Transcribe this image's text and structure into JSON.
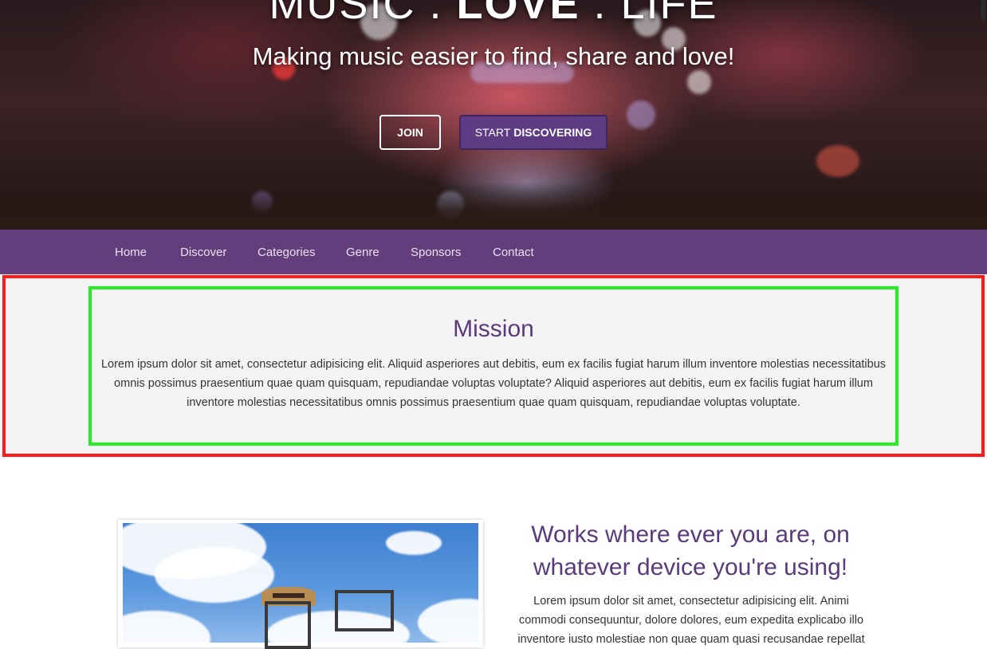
{
  "hero": {
    "title_part1": "MUSIC . ",
    "title_part2": "LOVE",
    "title_part3": " . LIFE",
    "subtitle": "Making music easier to find, share and love!",
    "join_label": "JOIN",
    "start_label_light": "START",
    "start_label_bold": "DISCOVERING"
  },
  "nav": {
    "items": [
      "Home",
      "Discover",
      "Categories",
      "Genre",
      "Sponsors",
      "Contact"
    ]
  },
  "mission": {
    "title": "Mission",
    "text": "Lorem ipsum dolor sit amet, consectetur adipisicing elit. Aliquid asperiores aut debitis, eum ex facilis fugiat harum illum inventore molestias necessitatibus omnis possimus praesentium quae quam quisquam, repudiandae voluptas voluptate? Aliquid asperiores aut debitis, eum ex facilis fugiat harum illum inventore molestias necessitatibus omnis possimus praesentium quae quam quisquam, repudiandae voluptas voluptate."
  },
  "feature": {
    "title": "Works where ever you are, on whatever device you're using!",
    "text": "Lorem ipsum dolor sit amet, consectetur adipisicing elit. Animi commodi consequuntur, dolore dolores, eum expedita explicabo illo inventore iusto molestiae non quae quam quasi recusandae repellat"
  },
  "colors": {
    "nav_bg": "#633d7c",
    "accent_button": "#5e3c84",
    "heading": "#5b3a7c",
    "mission_bg": "#f4f4f4",
    "highlight_red": "#ff1a1a",
    "highlight_green": "#22ee22"
  }
}
